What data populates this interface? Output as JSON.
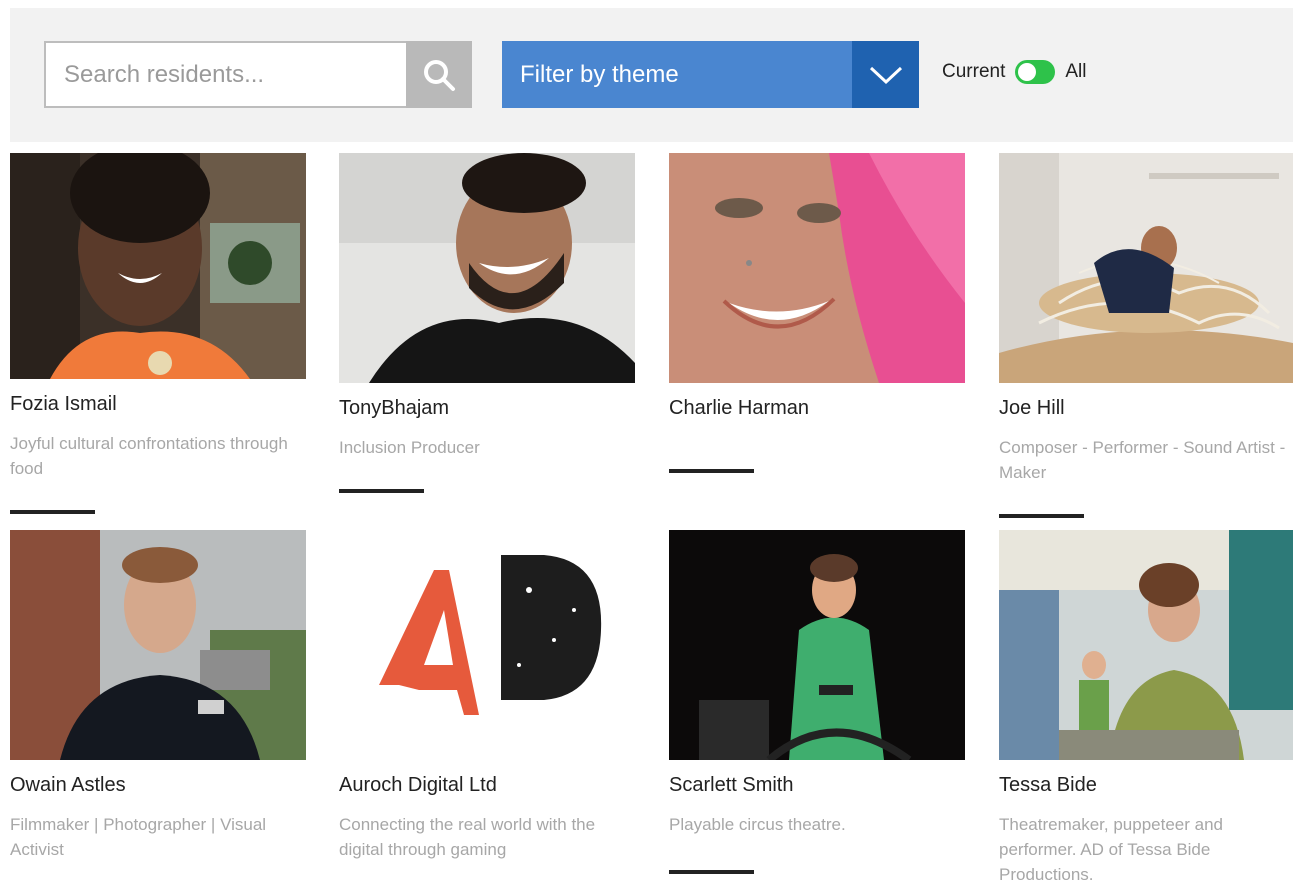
{
  "search": {
    "placeholder": "Search residents..."
  },
  "filter": {
    "label": "Filter by theme"
  },
  "toggle": {
    "left_label": "Current",
    "right_label": "All",
    "state": "on"
  },
  "residents": [
    {
      "name": "Fozia Ismail",
      "description": "Joyful cultural confrontations through food"
    },
    {
      "name": "TonyBhajam",
      "description": "Inclusion Producer"
    },
    {
      "name": "Charlie Harman",
      "description": ""
    },
    {
      "name": "Joe Hill",
      "description": "Composer - Performer - Sound Artist - Maker"
    },
    {
      "name": "Owain Astles",
      "description": "Filmmaker | Photographer | Visual Activist"
    },
    {
      "name": "Auroch Digital Ltd",
      "description": "Connecting the real world with the digital through gaming"
    },
    {
      "name": "Scarlett Smith",
      "description": "Playable circus theatre."
    },
    {
      "name": "Tessa Bide",
      "description": "Theatremaker, puppeteer and performer. AD of Tessa Bide Productions."
    }
  ],
  "logo": {
    "text": "AD"
  },
  "colors": {
    "accent_blue": "#4a86d0",
    "accent_blue_dark": "#1f62b0",
    "toggle_green": "#2ec24a"
  }
}
